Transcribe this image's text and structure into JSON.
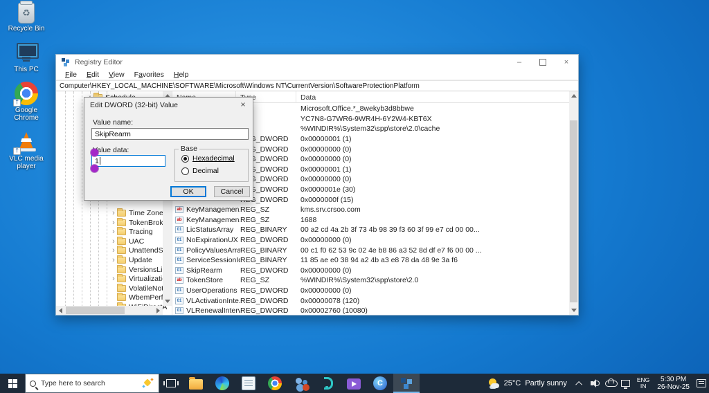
{
  "colors": {
    "accent": "#0078d7",
    "taskbar": "#1d2a39",
    "annotation": "#a428c8",
    "desktop_blue": "#1479cf"
  },
  "desktop": {
    "icons": [
      {
        "id": "recycle-bin",
        "label": "Recycle Bin"
      },
      {
        "id": "this-pc",
        "label": "This PC"
      },
      {
        "id": "google-chrome",
        "label": "Google Chrome"
      },
      {
        "id": "vlc",
        "label": "VLC media player"
      }
    ]
  },
  "window": {
    "title": "Registry Editor",
    "menus": [
      {
        "label": "File",
        "accel": 0
      },
      {
        "label": "Edit",
        "accel": 0
      },
      {
        "label": "View",
        "accel": 0
      },
      {
        "label": "Favorites",
        "accel": 1
      },
      {
        "label": "Help",
        "accel": 0
      }
    ],
    "address": "Computer\\HKEY_LOCAL_MACHINE\\SOFTWARE\\Microsoft\\Windows NT\\CurrentVersion\\SoftwareProtectionPlatform",
    "tree": {
      "items": [
        {
          "label": "Schedule",
          "expandable": true,
          "level": 1
        },
        {
          "label": "Time Zone",
          "expandable": true,
          "level": 2
        },
        {
          "label": "TokenBroke",
          "expandable": true,
          "level": 2
        },
        {
          "label": "Tracing",
          "expandable": true,
          "level": 2
        },
        {
          "label": "UAC",
          "expandable": true,
          "level": 2
        },
        {
          "label": "UnattendSe",
          "expandable": true,
          "level": 2
        },
        {
          "label": "Update",
          "expandable": true,
          "level": 2
        },
        {
          "label": "VersionsList",
          "expandable": false,
          "level": 2
        },
        {
          "label": "Virtualizatio",
          "expandable": true,
          "level": 2
        },
        {
          "label": "VolatileNot",
          "expandable": false,
          "level": 2
        },
        {
          "label": "WbemPerf",
          "expandable": false,
          "level": 2
        },
        {
          "label": "WiFiDirectA",
          "expandable": false,
          "level": 2
        }
      ]
    },
    "list": {
      "columns": [
        "Name",
        "Type",
        "Data"
      ],
      "rows": [
        {
          "name": "",
          "type": "",
          "icon": "",
          "data": "Microsoft.Office.*_8wekyb3d8bbwe"
        },
        {
          "name": "",
          "type": "",
          "icon": "",
          "data": "YC7N8-G7WR6-9WR4H-6Y2W4-KBT6X"
        },
        {
          "name": "",
          "type": "",
          "icon": "",
          "data": "%WINDIR%\\System32\\spp\\store\\2.0\\cache"
        },
        {
          "name": "",
          "type": "REG_DWORD",
          "icon": "",
          "data": "0x00000001 (1)"
        },
        {
          "name": "",
          "type": "REG_DWORD",
          "icon": "",
          "data": "0x00000000 (0)"
        },
        {
          "name": "",
          "type": "REG_DWORD",
          "icon": "",
          "data": "0x00000000 (0)"
        },
        {
          "name": "",
          "type": "REG_DWORD",
          "icon": "",
          "data": "0x00000001 (1)"
        },
        {
          "name": "",
          "type": "REG_DWORD",
          "icon": "",
          "data": "0x00000000 (0)"
        },
        {
          "name": "",
          "type": "REG_DWORD",
          "icon": "",
          "data": "0x0000001e (30)"
        },
        {
          "name": "",
          "type": "REG_DWORD",
          "icon": "",
          "data": "0x0000000f (15)"
        },
        {
          "name": "KeyManagemen...",
          "type": "REG_SZ",
          "icon": "sz",
          "data": "kms.srv.crsoo.com"
        },
        {
          "name": "KeyManagemen...",
          "type": "REG_SZ",
          "icon": "sz",
          "data": "1688"
        },
        {
          "name": "LicStatusArray",
          "type": "REG_BINARY",
          "icon": "bin",
          "data": "00 a2 cd 4a 2b 3f 73 4b 98 39 f3 60 3f 99 e7 cd 00 00..."
        },
        {
          "name": "NoExpirationUX",
          "type": "REG_DWORD",
          "icon": "bin",
          "data": "0x00000000 (0)"
        },
        {
          "name": "PolicyValuesArray",
          "type": "REG_BINARY",
          "icon": "bin",
          "data": "00 c1 f0 62 53 9c 02 4e b8 86 a3 52 8d df e7 f6 00 00 ..."
        },
        {
          "name": "ServiceSessionId",
          "type": "REG_BINARY",
          "icon": "bin",
          "data": "11 85 ae e0 38 94 a2 4b a3 e8 78 da 48 9e 3a f6"
        },
        {
          "name": "SkipRearm",
          "type": "REG_DWORD",
          "icon": "bin",
          "data": "0x00000000 (0)"
        },
        {
          "name": "TokenStore",
          "type": "REG_SZ",
          "icon": "sz",
          "data": "%WINDIR%\\System32\\spp\\store\\2.0"
        },
        {
          "name": "UserOperations",
          "type": "REG_DWORD",
          "icon": "bin",
          "data": "0x00000000 (0)"
        },
        {
          "name": "VLActivationInte...",
          "type": "REG_DWORD",
          "icon": "bin",
          "data": "0x00000078 (120)"
        },
        {
          "name": "VLRenewalInterval",
          "type": "REG_DWORD",
          "icon": "bin",
          "data": "0x00002760 (10080)"
        }
      ]
    }
  },
  "dialog": {
    "title": "Edit DWORD (32-bit) Value",
    "value_name_label": "Value name:",
    "value_name": "SkipRearm",
    "value_data_label": "Value data:",
    "value_data": "1",
    "base_label": "Base",
    "radio_hexadecimal": "Hexadecimal",
    "radio_decimal": "Decimal",
    "ok_label": "OK",
    "cancel_label": "Cancel"
  },
  "taskbar": {
    "search": {
      "placeholder": "Type here to search"
    },
    "apps": [
      {
        "name": "file-explorer",
        "active": false
      },
      {
        "name": "edge",
        "active": false
      },
      {
        "name": "notepad",
        "active": false
      },
      {
        "name": "chrome",
        "active": false
      },
      {
        "name": "people",
        "active": false
      },
      {
        "name": "teal-app",
        "active": false
      },
      {
        "name": "media-app",
        "active": false
      },
      {
        "name": "circle-app",
        "active": false
      },
      {
        "name": "registry-editor",
        "active": true
      }
    ],
    "tray": {
      "weather_temp": "25°C",
      "weather_desc": "Partly sunny",
      "lang_top": "ENG",
      "lang_bottom": "IN",
      "time": "5:30 PM",
      "date": "26-Nov-25"
    }
  }
}
